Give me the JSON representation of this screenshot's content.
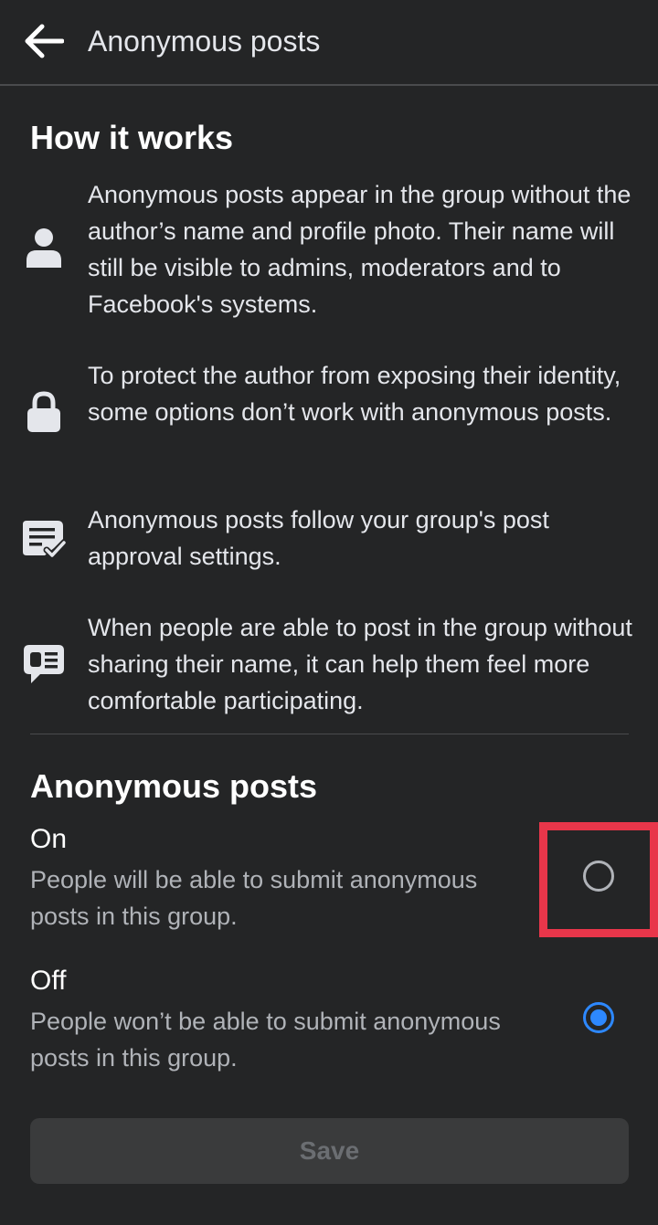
{
  "header": {
    "title": "Anonymous posts",
    "back_icon": "arrow-left-icon"
  },
  "how_it_works": {
    "heading": "How it works",
    "items": [
      {
        "icon": "person-icon",
        "text": "Anonymous posts appear in the group without the author’s name and profile photo. Their name will still be visible to admins, moderators and to Facebook's systems."
      },
      {
        "icon": "lock-icon",
        "text": "To protect the author from exposing their identity, some options don’t work with anonymous posts."
      },
      {
        "icon": "post-approval-icon",
        "text": "Anonymous posts follow your group's post approval settings."
      },
      {
        "icon": "chat-bubble-icon",
        "text": "When people are able to post in the group without sharing their name, it can help them feel more comfortable participating."
      }
    ]
  },
  "anonymous_posts": {
    "heading": "Anonymous posts",
    "options": [
      {
        "title": "On",
        "description": "People will be able to submit anonymous posts in this group.",
        "selected": false
      },
      {
        "title": "Off",
        "description": "People won’t be able to submit anonymous posts in this group.",
        "selected": true
      }
    ]
  },
  "footer": {
    "save_label": "Save",
    "save_enabled": false
  },
  "colors": {
    "background": "#242526",
    "accent": "#2d88ff",
    "highlight": "#e8364a"
  }
}
